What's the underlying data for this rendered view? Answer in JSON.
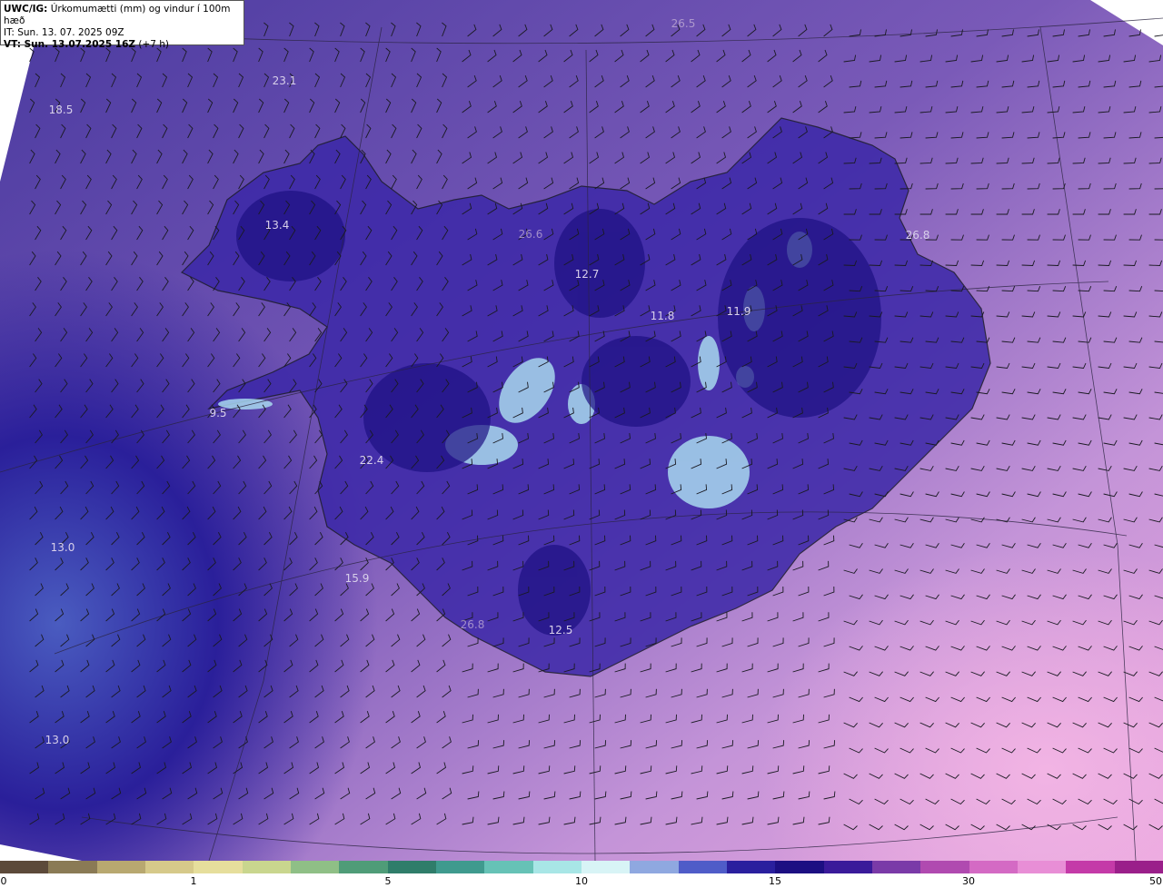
{
  "header": {
    "product": "UWC/IG:",
    "title": " Úrkomumætti (mm) og vindur í 100m hæð",
    "it_line": "IT: Sun. 13. 07. 2025 09Z",
    "vt_label": "VT: Sun. 13.07.2025 16Z",
    "vt_suffix": " (+7 h)"
  },
  "map_labels": [
    {
      "id": "lbl-1",
      "text": "26.5",
      "dim": true
    },
    {
      "id": "lbl-2",
      "text": "23.1",
      "dim": false
    },
    {
      "id": "lbl-3",
      "text": "18.5",
      "dim": false
    },
    {
      "id": "lbl-4",
      "text": "13.4",
      "dim": false
    },
    {
      "id": "lbl-5",
      "text": "26.6",
      "dim": true
    },
    {
      "id": "lbl-6",
      "text": "12.7",
      "dim": false
    },
    {
      "id": "lbl-7",
      "text": "11.8",
      "dim": false
    },
    {
      "id": "lbl-8",
      "text": "11.9",
      "dim": false
    },
    {
      "id": "lbl-9",
      "text": "26.8",
      "dim": false
    },
    {
      "id": "lbl-10",
      "text": "9.5",
      "dim": false
    },
    {
      "id": "lbl-11",
      "text": "22.4",
      "dim": false
    },
    {
      "id": "lbl-12",
      "text": "13.0",
      "dim": false
    },
    {
      "id": "lbl-13",
      "text": "15.9",
      "dim": false
    },
    {
      "id": "lbl-14",
      "text": "26.8",
      "dim": true
    },
    {
      "id": "lbl-15",
      "text": "12.5",
      "dim": false
    },
    {
      "id": "lbl-16",
      "text": "13.0",
      "dim": false
    }
  ],
  "colorbar": {
    "ticks": [
      "0",
      "1",
      "5",
      "10",
      "15",
      "30",
      "50"
    ],
    "colors": [
      "#5c4a3a",
      "#8a7a55",
      "#b8a870",
      "#d6c98a",
      "#e6de9c",
      "#c9d68e",
      "#8fbf86",
      "#4f9c78",
      "#2f7d6a",
      "#3f9a8e",
      "#66c2b6",
      "#a8e6e6",
      "#d8f4f6",
      "#8fa8e0",
      "#4f5cc8",
      "#2a1f9e",
      "#1c0f82",
      "#3a1a9a",
      "#7a3aa8",
      "#b04ab0",
      "#d46ac4",
      "#e88ed6",
      "#c43aa8",
      "#9a1f8a"
    ]
  }
}
